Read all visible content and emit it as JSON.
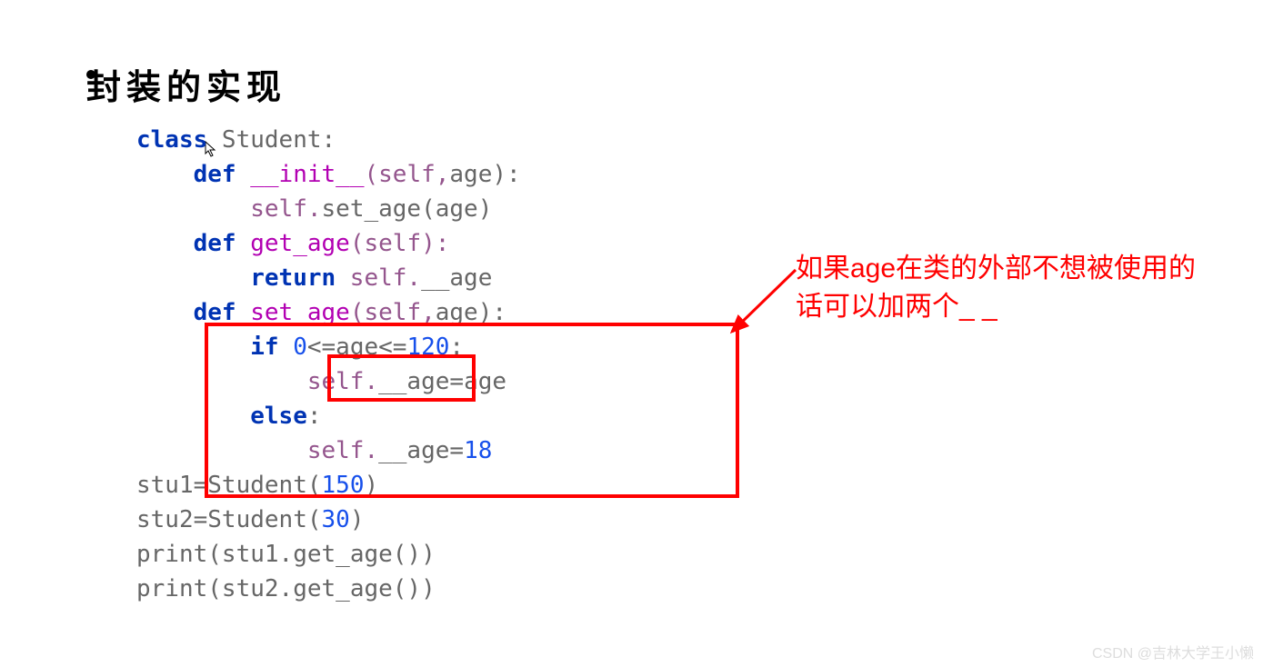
{
  "heading": "封装的实现",
  "code": {
    "l1_kw": "class",
    "l1_name": " Student:",
    "l2_kw": "def",
    "l2_fn": " __init__",
    "l2_sp": "(self,",
    "l2_arg": "age):",
    "l3_sp": "self.",
    "l3_call": "set_age",
    "l3_arg": "(age)",
    "l4_kw": "def",
    "l4_fn": " get_age",
    "l4_sp": "(self):",
    "l5_kw": "return",
    "l5_sp": " self.",
    "l5_attr": "__age",
    "l6_kw": "def",
    "l6_fn": " set_age",
    "l6_sp": "(self,",
    "l6_arg": "age):",
    "l7_kw": "if",
    "l7_cond1": " 0",
    "l7_op1": "<=",
    "l7_var1": "age",
    "l7_op2": "<=",
    "l7_cond2": "120",
    "l7_end": ":",
    "l8_sp": "self.",
    "l8_attr": "__age",
    "l8_eq": "=",
    "l8_val": "age",
    "l9_kw": "else",
    "l9_end": ":",
    "l10_sp": "self.",
    "l10_attr": "__age",
    "l10_eq": "=",
    "l10_val": "18",
    "l11_var": "stu1",
    "l11_eq": "=",
    "l11_cls": "Student",
    "l11_op": "(",
    "l11_num": "150",
    "l11_cp": ")",
    "l12_var": "stu2",
    "l12_eq": "=",
    "l12_cls": "Student",
    "l12_op": "(",
    "l12_num": "30",
    "l12_cp": ")",
    "l13_fn": "print",
    "l13_arg": "(stu1.",
    "l13_call": "get_age",
    "l13_end": "())",
    "l14_fn": "print",
    "l14_arg": "(stu2.",
    "l14_call": "get_age",
    "l14_end": "())"
  },
  "annotation_line1": "如果age在类的外部不想被使用的",
  "annotation_line2": "话可以加两个_ _",
  "watermark": "CSDN @吉林大学王小懒"
}
